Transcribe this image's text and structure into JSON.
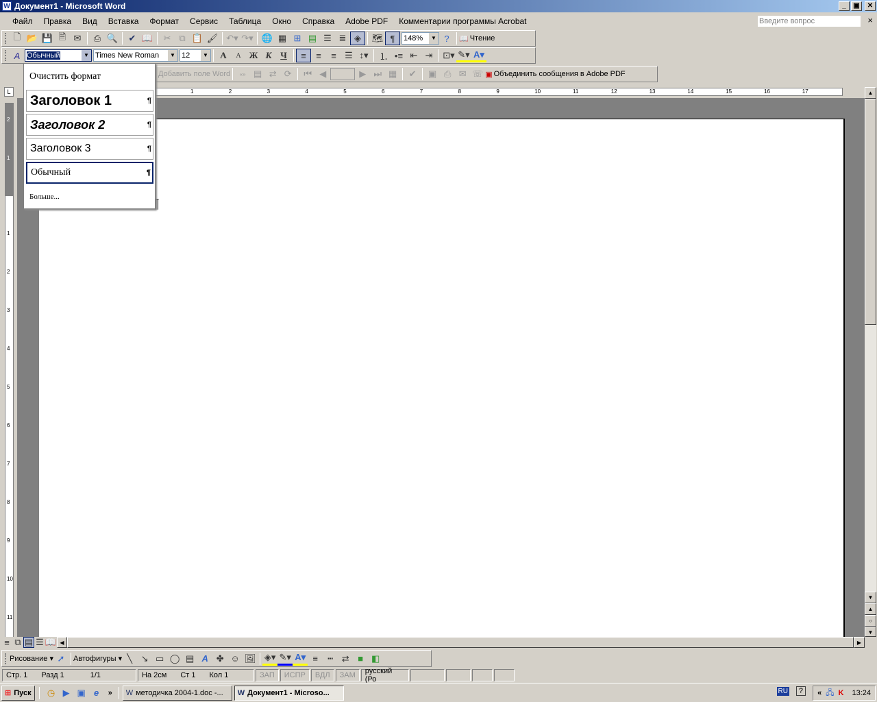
{
  "window": {
    "title": "Документ1 - Microsoft Word",
    "minimize": "_",
    "restore": "▣",
    "close": "✕"
  },
  "menu": {
    "items": [
      "Файл",
      "Правка",
      "Вид",
      "Вставка",
      "Формат",
      "Сервис",
      "Таблица",
      "Окно",
      "Справка",
      "Adobe PDF",
      "Комментарии программы Acrobat"
    ],
    "ask_placeholder": "Введите вопрос",
    "close": "×"
  },
  "standard_toolbar": {
    "zoom": "148%",
    "reading": "Чтение",
    "pilcrow": "¶"
  },
  "format_toolbar": {
    "style": "Обычный",
    "font": "Times New Roman",
    "size": "12",
    "bold": "Ж",
    "italic": "К",
    "underline": "Ч"
  },
  "mailmerge_toolbar": {
    "insert_field": "Добавить поле Word",
    "merge_pdf": "Объединить сообщения в Adobe PDF"
  },
  "style_menu": {
    "items": [
      {
        "label": "Очистить формат"
      },
      {
        "label": "Заголовок 1",
        "mark": "¶"
      },
      {
        "label": "Заголовок 2",
        "mark": "¶"
      },
      {
        "label": "Заголовок 3",
        "mark": "¶"
      },
      {
        "label": "Обычный",
        "mark": "¶"
      }
    ],
    "more": "Больше..."
  },
  "ruler": {
    "h_numbers": [
      "1",
      "2",
      "3",
      "4",
      "5",
      "6",
      "7",
      "8",
      "9",
      "10",
      "11",
      "12",
      "13",
      "14",
      "15",
      "16",
      "17"
    ],
    "v_top": [
      "2",
      "1"
    ],
    "v_numbers": [
      "1",
      "2",
      "3",
      "4",
      "5",
      "6",
      "7",
      "8",
      "9",
      "10",
      "11"
    ]
  },
  "document": {
    "pilcrow": "¶"
  },
  "drawing_toolbar": {
    "draw": "Рисование",
    "autoshapes": "Автофигуры"
  },
  "status": {
    "page": "Стр. 1",
    "section": "Разд 1",
    "pages": "1/1",
    "at": "На 2см",
    "line": "Ст 1",
    "col": "Кол 1",
    "rec": "ЗАП",
    "trk": "ИСПР",
    "ext": "ВДЛ",
    "ovr": "ЗАМ",
    "lang": "русский (Ро"
  },
  "taskbar": {
    "start": "Пуск",
    "more": "»",
    "tasks": [
      "методичка 2004-1.doc -...",
      "Документ1 - Microso..."
    ],
    "lang": "RU",
    "time": "13:24",
    "chevrons": "«"
  }
}
